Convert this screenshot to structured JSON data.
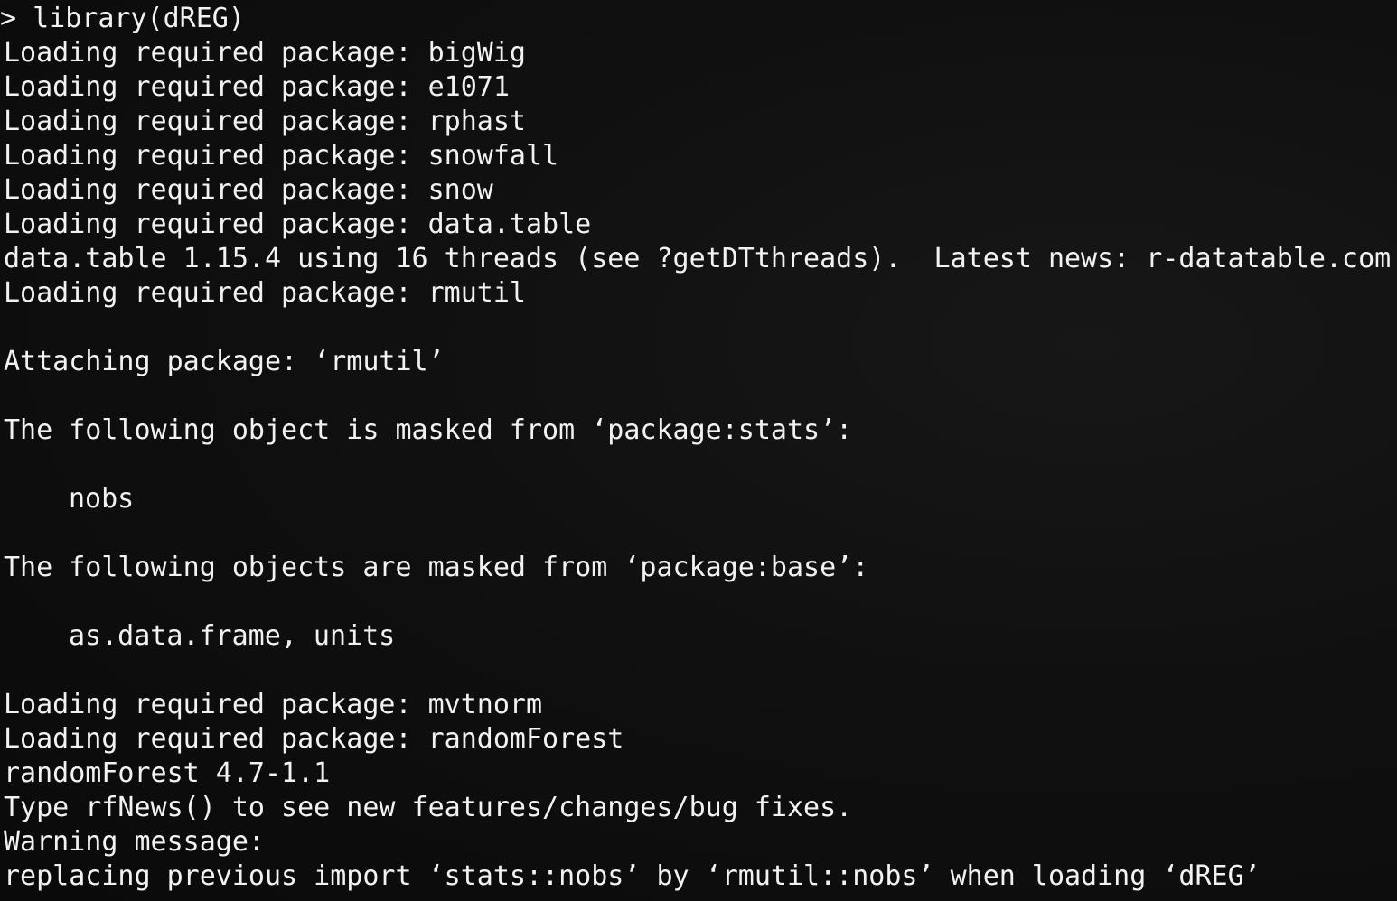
{
  "terminal": {
    "command_prompt": ">",
    "command": "library(dREG)",
    "lines": [
      "Loading required package: bigWig",
      "Loading required package: e1071",
      "Loading required package: rphast",
      "Loading required package: snowfall",
      "Loading required package: snow",
      "Loading required package: data.table",
      "data.table 1.15.4 using 16 threads (see ?getDTthreads).  Latest news: r-datatable.com",
      "Loading required package: rmutil",
      "",
      "Attaching package: ‘rmutil’",
      "",
      "The following object is masked from ‘package:stats’:",
      "",
      "nobs",
      "",
      "The following objects are masked from ‘package:base’:",
      "",
      "as.data.frame, units",
      "",
      "Loading required package: mvtnorm",
      "Loading required package: randomForest",
      "randomForest 4.7-1.1",
      "Type rfNews() to see new features/changes/bug fixes.",
      "Warning message:",
      "replacing previous import ‘stats::nobs’ by ‘rmutil::nobs’ when loading ‘dREG’"
    ]
  },
  "colors": {
    "background": "#0b0b0b",
    "text": "#f2f2f2"
  }
}
